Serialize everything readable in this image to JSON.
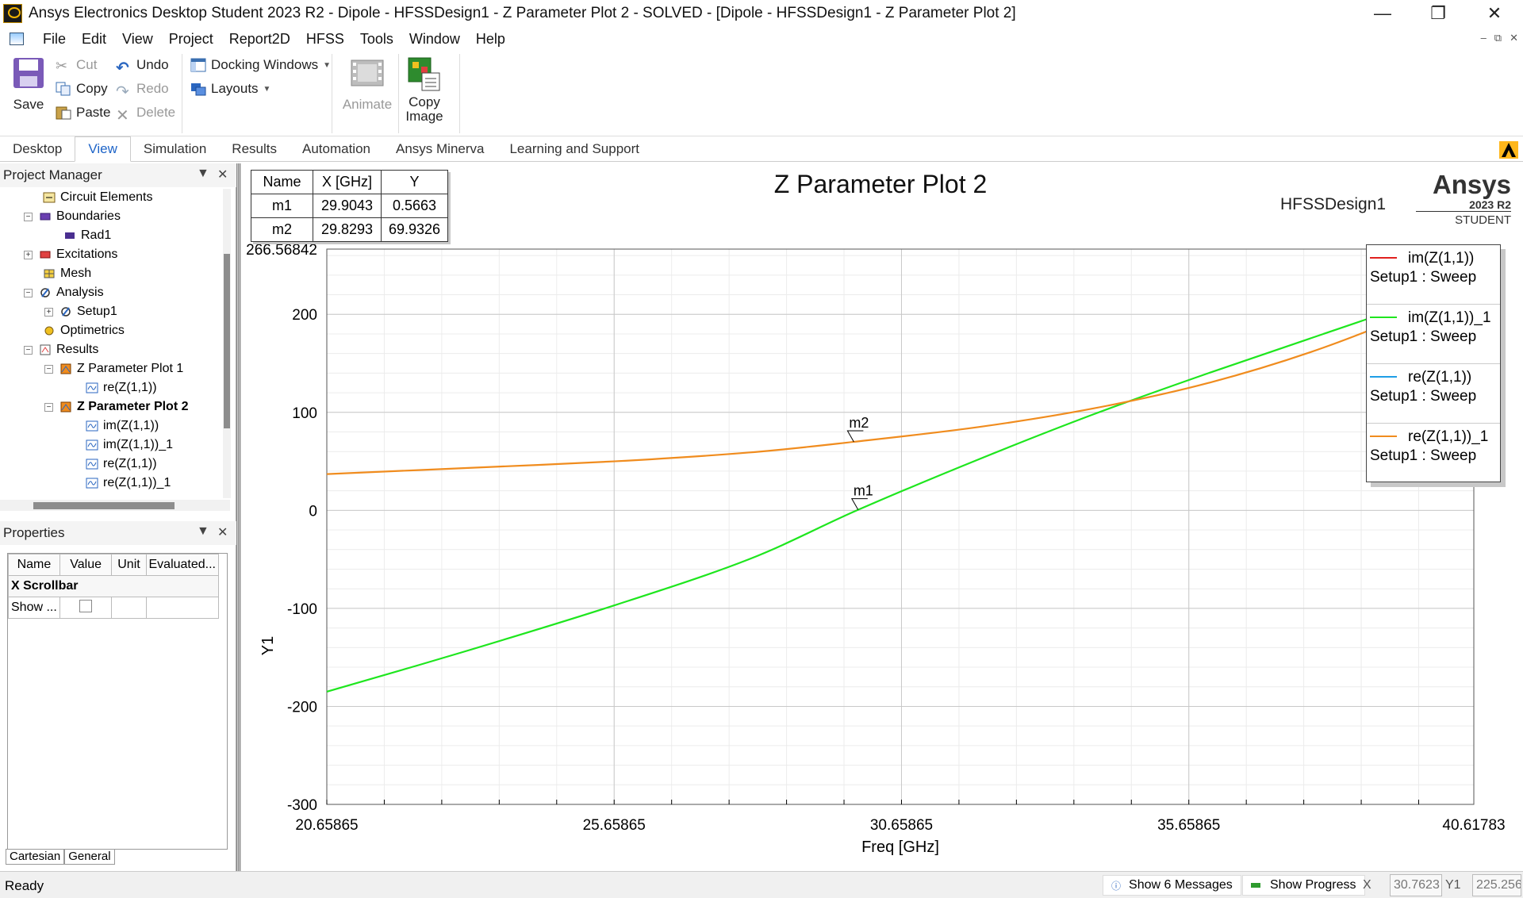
{
  "window": {
    "title": "Ansys Electronics Desktop Student 2023 R2 - Dipole - HFSSDesign1 - Z Parameter Plot 2 - SOLVED - [Dipole - HFSSDesign1 - Z Parameter Plot 2]"
  },
  "menu": [
    "File",
    "Edit",
    "View",
    "Project",
    "Report2D",
    "HFSS",
    "Tools",
    "Window",
    "Help"
  ],
  "ribbon": {
    "save": "Save",
    "cut": "Cut",
    "copy": "Copy",
    "paste": "Paste",
    "undo": "Undo",
    "redo": "Redo",
    "delete": "Delete",
    "docking": "Docking Windows",
    "layouts": "Layouts",
    "animate": "Animate",
    "copy_image_1": "Copy",
    "copy_image_2": "Image"
  },
  "tabs": [
    "Desktop",
    "View",
    "Simulation",
    "Results",
    "Automation",
    "Ansys Minerva",
    "Learning and Support"
  ],
  "project_manager": {
    "title": "Project Manager",
    "tree": [
      {
        "label": "Circuit Elements"
      },
      {
        "label": "Boundaries"
      },
      {
        "label": "Rad1"
      },
      {
        "label": "Excitations"
      },
      {
        "label": "Mesh"
      },
      {
        "label": "Analysis"
      },
      {
        "label": "Setup1"
      },
      {
        "label": "Optimetrics"
      },
      {
        "label": "Results"
      },
      {
        "label": "Z Parameter Plot 1"
      },
      {
        "label": "re(Z(1,1))"
      },
      {
        "label": "Z Parameter Plot 2"
      },
      {
        "label": "im(Z(1,1))"
      },
      {
        "label": "im(Z(1,1))_1"
      },
      {
        "label": "re(Z(1,1))"
      },
      {
        "label": "re(Z(1,1))_1"
      }
    ]
  },
  "properties": {
    "title": "Properties",
    "headers": [
      "Name",
      "Value",
      "Unit",
      "Evaluated..."
    ],
    "group": "X Scrollbar",
    "row_name": "Show ...",
    "tabs": [
      "Cartesian",
      "General"
    ]
  },
  "plot": {
    "design": "HFSSDesign1",
    "logo": {
      "brand": "Ansys",
      "version": "2023 R2",
      "edition": "STUDENT"
    },
    "marker_table": {
      "headers": [
        "Name",
        "X [GHz]",
        "Y"
      ],
      "rows": [
        [
          "m1",
          "29.9043",
          "0.5663"
        ],
        [
          "m2",
          "29.8293",
          "69.9326"
        ]
      ]
    },
    "legend": [
      {
        "name": "im(Z(1,1))",
        "setup": "Setup1 : Sweep",
        "color": "#e0201e"
      },
      {
        "name": "im(Z(1,1))_1",
        "setup": "Setup1 : Sweep",
        "color": "#1ee61e"
      },
      {
        "name": "re(Z(1,1))",
        "setup": "Setup1 : Sweep",
        "color": "#1e9ee6"
      },
      {
        "name": "re(Z(1,1))_1",
        "setup": "Setup1 : Sweep",
        "color": "#f08c1e"
      }
    ]
  },
  "chart_data": {
    "type": "line",
    "title": "Z Parameter Plot 2",
    "xlabel": "Freq [GHz]",
    "ylabel": "Y1",
    "xlim": [
      20.65865,
      40.61783
    ],
    "ylim": [
      -300,
      266.56842
    ],
    "x_ticks": [
      "20.65865",
      "25.65865",
      "30.65865",
      "35.65865",
      "40.61783"
    ],
    "y_ticks": [
      "266.56842",
      "200",
      "100",
      "0",
      "-100",
      "-200",
      "-300"
    ],
    "grid": true,
    "legend_position": "top-right",
    "series": [
      {
        "name": "im(Z(1,1))_1",
        "color": "#1ee61e",
        "x": [
          20.65865,
          23.0,
          25.65865,
          28.0,
          29.9043,
          32.0,
          34.0,
          36.0,
          38.0,
          40.0,
          40.61783
        ],
        "y": [
          -185,
          -145,
          -97,
          -50,
          0.5663,
          52,
          98,
          140,
          180,
          219,
          225
        ]
      },
      {
        "name": "re(Z(1,1))_1",
        "color": "#f08c1e",
        "x": [
          20.65865,
          23.0,
          25.65865,
          28.0,
          29.8293,
          32.0,
          34.0,
          36.0,
          38.0,
          40.0,
          40.61783
        ],
        "y": [
          37,
          43,
          50,
          59,
          69.9326,
          85,
          104,
          130,
          166,
          213,
          235
        ]
      }
    ],
    "markers": [
      {
        "name": "m1",
        "x": 29.9043,
        "y": 0.5663
      },
      {
        "name": "m2",
        "x": 29.8293,
        "y": 69.9326
      }
    ]
  },
  "status": {
    "text": "Ready",
    "messages": "Show 6 Messages",
    "progress": "Show Progress",
    "x_label": "X",
    "x_value": "30.7623",
    "y_label": "Y1",
    "y_value": "225.256"
  }
}
